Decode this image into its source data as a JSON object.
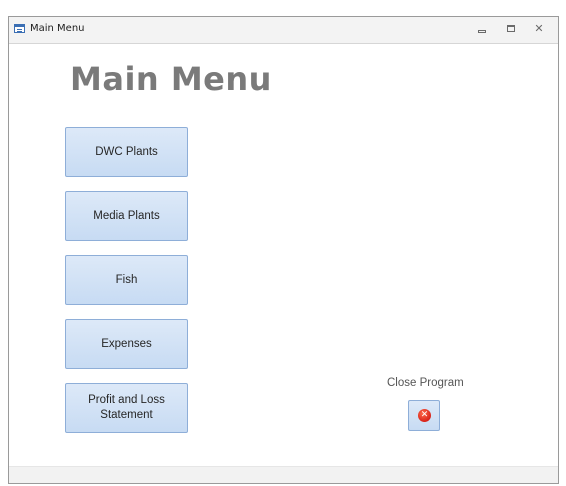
{
  "window": {
    "title": "Main Menu",
    "controls": {
      "minimize": "minimize",
      "maximize": "maximize",
      "close": "✕"
    }
  },
  "form": {
    "heading": "Main Menu",
    "buttons": [
      {
        "label": "DWC Plants"
      },
      {
        "label": "Media Plants"
      },
      {
        "label": "Fish"
      },
      {
        "label": "Expenses"
      },
      {
        "label": "Profit and Loss Statement"
      }
    ],
    "close": {
      "label": "Close Program",
      "icon": "close-circle-icon",
      "glyph": "✕"
    }
  },
  "colors": {
    "button_fill": "#d3e3f6",
    "button_border": "#8eaed8",
    "heading": "#7a7a7a",
    "close_icon": "#d8231a"
  }
}
